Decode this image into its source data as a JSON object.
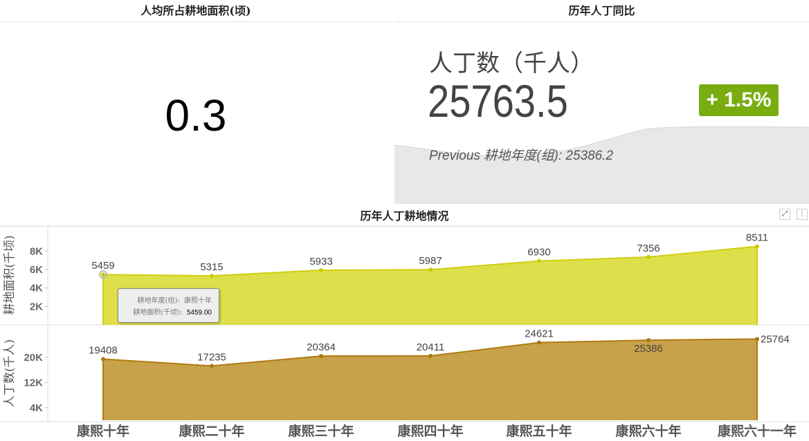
{
  "panel1": {
    "title": "人均所占耕地面积(顷)",
    "value": "0.3"
  },
  "panel2": {
    "title": "历年人丁同比",
    "label": "人丁数（千人）",
    "value": "25763.5",
    "change": "+ 1.5%",
    "previous": "Previous 耕地年度(组): 25386.2",
    "accent": "#78ac11"
  },
  "panel3": {
    "title": "历年人丁耕地情况",
    "expand_icon": "expand-icon",
    "menu_icon": "more-vertical-icon",
    "tooltip": {
      "row1_label": "耕地年度(组):",
      "row1_value": "康熙十年",
      "row2_label": "耕地面积(千顷):",
      "row2_value": "5459.00"
    }
  },
  "chart_data": [
    {
      "type": "area",
      "title": "历年人丁耕地情况",
      "ylabel": "耕地面积(千顷)",
      "categories": [
        "康熙十年",
        "康熙二十年",
        "康熙三十年",
        "康熙四十年",
        "康熙五十年",
        "康熙六十年",
        "康熙六十一年"
      ],
      "values": [
        5459,
        5315,
        5933,
        5987,
        6930,
        7356,
        8511
      ],
      "yticks": [
        "2K",
        "4K",
        "6K",
        "8K"
      ],
      "ytick_values": [
        2000,
        4000,
        6000,
        8000
      ],
      "color": "#dde04a"
    },
    {
      "type": "area",
      "ylabel": "人丁数(千人)",
      "categories": [
        "康熙十年",
        "康熙二十年",
        "康熙三十年",
        "康熙四十年",
        "康熙五十年",
        "康熙六十年",
        "康熙六十一年"
      ],
      "values": [
        19408,
        17235,
        20364,
        20411,
        24621,
        25386,
        25764
      ],
      "yticks": [
        "4K",
        "12K",
        "20K"
      ],
      "ytick_values": [
        4000,
        12000,
        20000
      ],
      "color": "#c8a24a"
    }
  ]
}
